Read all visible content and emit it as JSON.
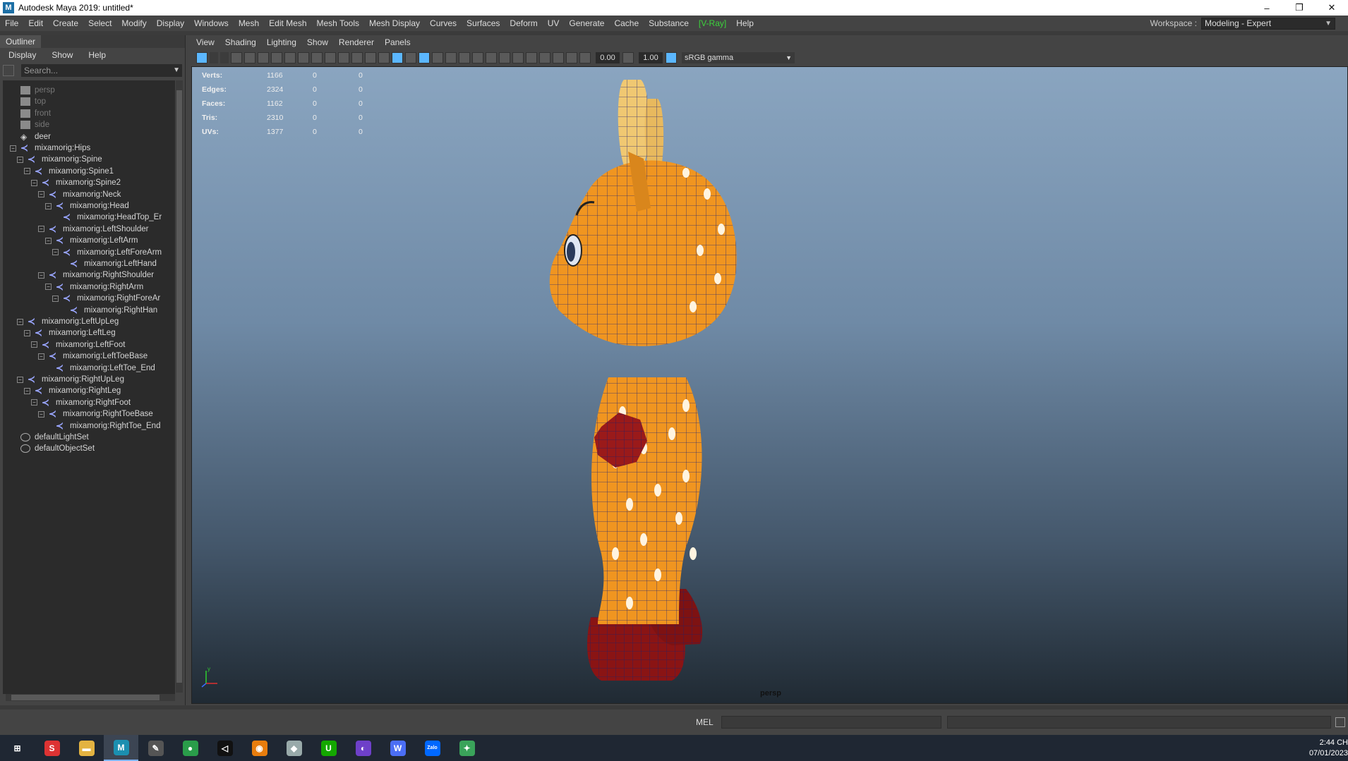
{
  "window": {
    "title": "Autodesk Maya 2019: untitled*",
    "app_icon": "M",
    "controls": [
      "–",
      "❐",
      "✕"
    ]
  },
  "menubar": {
    "items": [
      "File",
      "Edit",
      "Create",
      "Select",
      "Modify",
      "Display",
      "Windows",
      "Mesh",
      "Edit Mesh",
      "Mesh Tools",
      "Mesh Display",
      "Curves",
      "Surfaces",
      "Deform",
      "UV",
      "Generate",
      "Cache",
      "Substance",
      "[V-Ray]",
      "Help"
    ],
    "workspace_label": "Workspace :",
    "workspace_value": "Modeling - Expert"
  },
  "outliner": {
    "tab": "Outliner",
    "menu": [
      "Display",
      "Show",
      "Help"
    ],
    "search_placeholder": "Search...",
    "tree": [
      {
        "label": "persp",
        "type": "camera",
        "depth": 1,
        "dim": true,
        "exp": ""
      },
      {
        "label": "top",
        "type": "camera",
        "depth": 1,
        "dim": true,
        "exp": ""
      },
      {
        "label": "front",
        "type": "camera",
        "depth": 1,
        "dim": true,
        "exp": ""
      },
      {
        "label": "side",
        "type": "camera",
        "depth": 1,
        "dim": true,
        "exp": ""
      },
      {
        "label": "deer",
        "type": "mesh",
        "depth": 1,
        "dim": false,
        "exp": ""
      },
      {
        "label": "mixamorig:Hips",
        "type": "joint",
        "depth": 1,
        "dim": false,
        "exp": "−"
      },
      {
        "label": "mixamorig:Spine",
        "type": "joint",
        "depth": 2,
        "dim": false,
        "exp": "−"
      },
      {
        "label": "mixamorig:Spine1",
        "type": "joint",
        "depth": 3,
        "dim": false,
        "exp": "−"
      },
      {
        "label": "mixamorig:Spine2",
        "type": "joint",
        "depth": 4,
        "dim": false,
        "exp": "−"
      },
      {
        "label": "mixamorig:Neck",
        "type": "joint",
        "depth": 5,
        "dim": false,
        "exp": "−"
      },
      {
        "label": "mixamorig:Head",
        "type": "joint",
        "depth": 6,
        "dim": false,
        "exp": "−"
      },
      {
        "label": "mixamorig:HeadTop_Er",
        "type": "joint",
        "depth": 7,
        "dim": false,
        "exp": ""
      },
      {
        "label": "mixamorig:LeftShoulder",
        "type": "joint",
        "depth": 5,
        "dim": false,
        "exp": "−"
      },
      {
        "label": "mixamorig:LeftArm",
        "type": "joint",
        "depth": 6,
        "dim": false,
        "exp": "−"
      },
      {
        "label": "mixamorig:LeftForeArm",
        "type": "joint",
        "depth": 7,
        "dim": false,
        "exp": "−"
      },
      {
        "label": "mixamorig:LeftHand",
        "type": "joint",
        "depth": 8,
        "dim": false,
        "exp": ""
      },
      {
        "label": "mixamorig:RightShoulder",
        "type": "joint",
        "depth": 5,
        "dim": false,
        "exp": "−"
      },
      {
        "label": "mixamorig:RightArm",
        "type": "joint",
        "depth": 6,
        "dim": false,
        "exp": "−"
      },
      {
        "label": "mixamorig:RightForeAr",
        "type": "joint",
        "depth": 7,
        "dim": false,
        "exp": "−"
      },
      {
        "label": "mixamorig:RightHan",
        "type": "joint",
        "depth": 8,
        "dim": false,
        "exp": ""
      },
      {
        "label": "mixamorig:LeftUpLeg",
        "type": "joint",
        "depth": 2,
        "dim": false,
        "exp": "−"
      },
      {
        "label": "mixamorig:LeftLeg",
        "type": "joint",
        "depth": 3,
        "dim": false,
        "exp": "−"
      },
      {
        "label": "mixamorig:LeftFoot",
        "type": "joint",
        "depth": 4,
        "dim": false,
        "exp": "−"
      },
      {
        "label": "mixamorig:LeftToeBase",
        "type": "joint",
        "depth": 5,
        "dim": false,
        "exp": "−"
      },
      {
        "label": "mixamorig:LeftToe_End",
        "type": "joint",
        "depth": 6,
        "dim": false,
        "exp": ""
      },
      {
        "label": "mixamorig:RightUpLeg",
        "type": "joint",
        "depth": 2,
        "dim": false,
        "exp": "−"
      },
      {
        "label": "mixamorig:RightLeg",
        "type": "joint",
        "depth": 3,
        "dim": false,
        "exp": "−"
      },
      {
        "label": "mixamorig:RightFoot",
        "type": "joint",
        "depth": 4,
        "dim": false,
        "exp": "−"
      },
      {
        "label": "mixamorig:RightToeBase",
        "type": "joint",
        "depth": 5,
        "dim": false,
        "exp": "−"
      },
      {
        "label": "mixamorig:RightToe_End",
        "type": "joint",
        "depth": 6,
        "dim": false,
        "exp": ""
      },
      {
        "label": "defaultLightSet",
        "type": "set",
        "depth": 1,
        "dim": false,
        "exp": ""
      },
      {
        "label": "defaultObjectSet",
        "type": "set",
        "depth": 1,
        "dim": false,
        "exp": ""
      }
    ]
  },
  "viewport": {
    "menu": [
      "View",
      "Shading",
      "Lighting",
      "Show",
      "Renderer",
      "Panels"
    ],
    "exposure": "0.00",
    "gamma": "1.00",
    "color_space": "sRGB gamma",
    "hud": [
      {
        "label": "Verts:",
        "v1": "1166",
        "v2": "0",
        "v3": "0"
      },
      {
        "label": "Edges:",
        "v1": "2324",
        "v2": "0",
        "v3": "0"
      },
      {
        "label": "Faces:",
        "v1": "1162",
        "v2": "0",
        "v3": "0"
      },
      {
        "label": "Tris:",
        "v1": "2310",
        "v2": "0",
        "v3": "0"
      },
      {
        "label": "UVs:",
        "v1": "1377",
        "v2": "0",
        "v3": "0"
      }
    ],
    "camera": "persp",
    "axis_label": "y"
  },
  "cmdline": {
    "label": "MEL"
  },
  "taskbar": {
    "apps": [
      {
        "name": "windows-start",
        "glyph": "⊞",
        "color": "#1f2733"
      },
      {
        "name": "security-app",
        "glyph": "S",
        "color": "#d33"
      },
      {
        "name": "file-explorer",
        "glyph": "▬",
        "color": "#e3b341"
      },
      {
        "name": "maya",
        "glyph": "M",
        "color": "#1b8fb0"
      },
      {
        "name": "inkscape",
        "glyph": "✎",
        "color": "#555"
      },
      {
        "name": "chrome",
        "glyph": "●",
        "color": "#2a9d4a"
      },
      {
        "name": "unity",
        "glyph": "◁",
        "color": "#111"
      },
      {
        "name": "blender",
        "glyph": "◉",
        "color": "#e87d0d"
      },
      {
        "name": "game-app",
        "glyph": "◆",
        "color": "#9aa"
      },
      {
        "name": "upwork",
        "glyph": "U",
        "color": "#14a800"
      },
      {
        "name": "github",
        "glyph": "◐",
        "color": "#6e40c9"
      },
      {
        "name": "w-app",
        "glyph": "W",
        "color": "#4b6ef5"
      },
      {
        "name": "zalo",
        "glyph": "Zalo",
        "color": "#0068ff"
      },
      {
        "name": "maps-app",
        "glyph": "✦",
        "color": "#3aa35a"
      }
    ],
    "active": "maya",
    "time": "2:44 CH",
    "date": "07/01/2023"
  }
}
